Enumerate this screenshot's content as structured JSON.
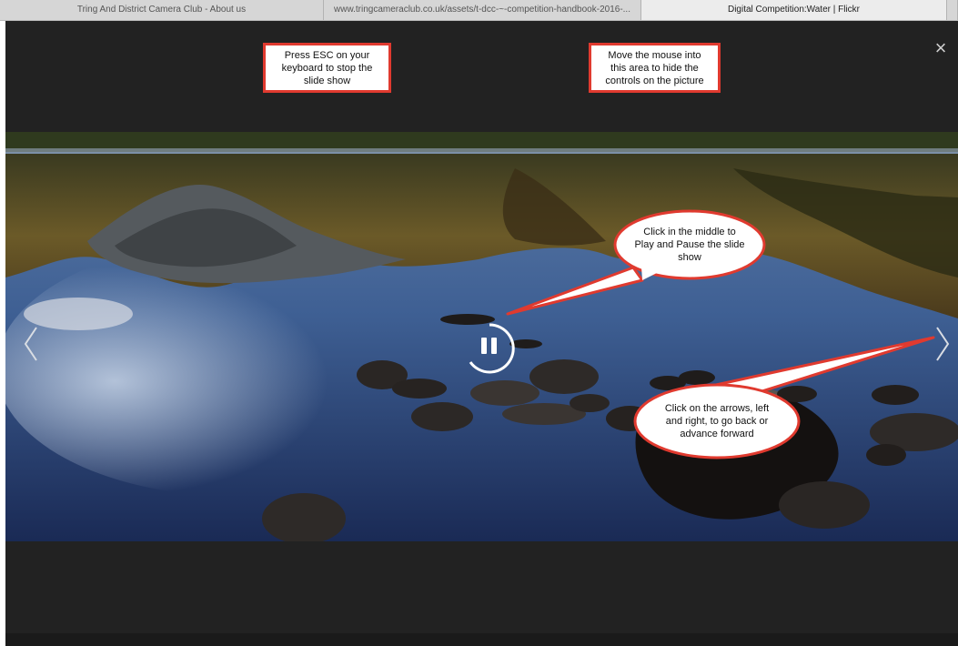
{
  "browser": {
    "tabs": [
      {
        "label": "Tring And District Camera Club - About us"
      },
      {
        "label": "www.tringcameraclub.co.uk/assets/t-dcc-~-competition-handbook-2016-..."
      },
      {
        "label": "Digital Competition:Water | Flickr"
      }
    ]
  },
  "annotations": {
    "esc_note": "Press ESC on your\nkeyboard to stop the\nslide show",
    "hide_note": "Move the mouse into\nthis area to hide the\ncontrols on the picture",
    "play_note": "Click in the middle to\nPlay and Pause the slide\nshow",
    "arrows_note": "Click on the arrows, left\nand right, to go back or\nadvance forward"
  },
  "viewer": {
    "close_glyph": "×",
    "state": "playing",
    "icons": [
      "close-icon",
      "chevron-left-icon",
      "chevron-right-icon",
      "pause-icon"
    ]
  },
  "colors": {
    "callout_border": "#e03a2f",
    "viewer_bg": "#222222"
  }
}
